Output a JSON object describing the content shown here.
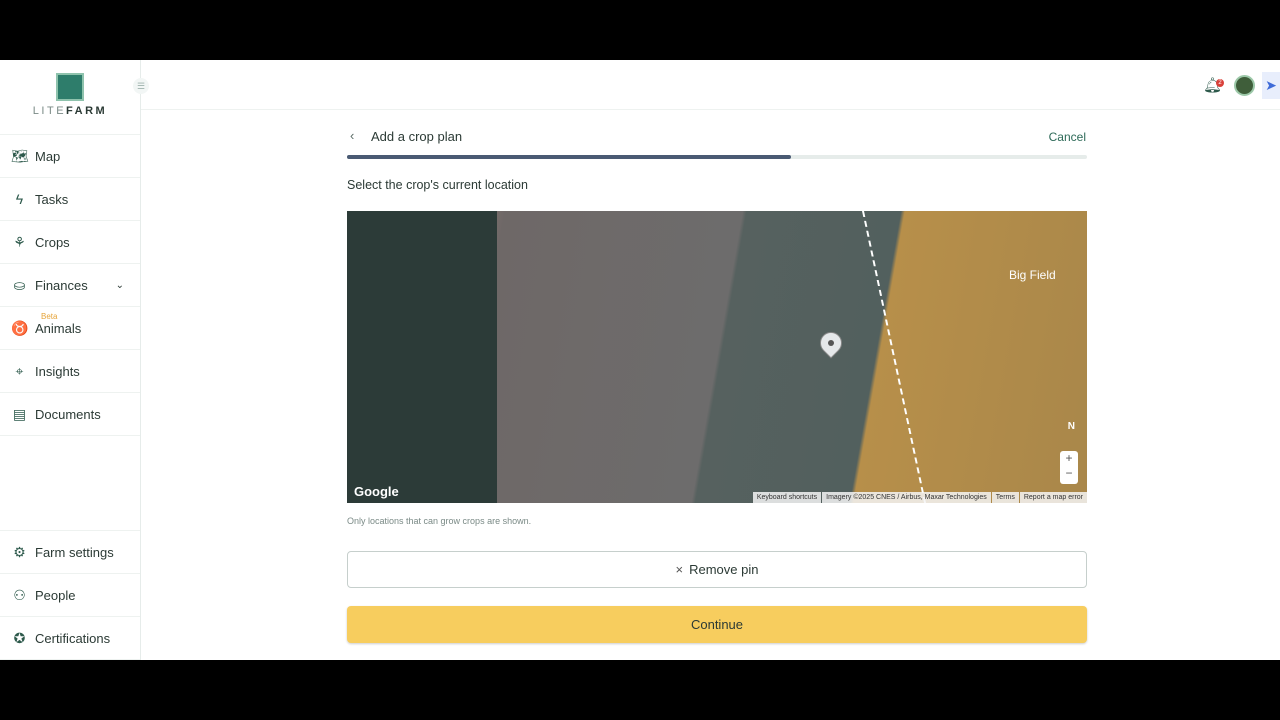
{
  "brand": {
    "lite": "LITE",
    "farm": "FARM"
  },
  "sidebar": {
    "items": [
      {
        "label": "Map",
        "icon": "🗺"
      },
      {
        "label": "Tasks",
        "icon": "ϟ"
      },
      {
        "label": "Crops",
        "icon": "⚘"
      },
      {
        "label": "Finances",
        "icon": "⛀",
        "chevron": "⌄"
      },
      {
        "label": "Animals",
        "icon": "♉",
        "badge": "Beta"
      },
      {
        "label": "Insights",
        "icon": "⌖"
      },
      {
        "label": "Documents",
        "icon": "▤"
      }
    ],
    "bottom": [
      {
        "label": "Farm settings",
        "icon": "⚙"
      },
      {
        "label": "People",
        "icon": "⚇"
      },
      {
        "label": "Certifications",
        "icon": "✪"
      }
    ]
  },
  "topbar": {
    "notification_count": "2"
  },
  "header": {
    "back": "‹",
    "title": "Add a crop plan",
    "cancel": "Cancel",
    "progress_percent": 60
  },
  "prompt": "Select the crop's current location",
  "map": {
    "field_label": "Big Field",
    "google": "Google",
    "north": "N",
    "zoom_in": "+",
    "zoom_out": "−",
    "attribution": [
      "Keyboard shortcuts",
      "Imagery ©2025 CNES / Airbus, Maxar Technologies",
      "Terms",
      "Report a map error"
    ]
  },
  "hint": "Only locations that can grow crops are shown.",
  "remove_pin": {
    "icon": "×",
    "label": "Remove pin"
  },
  "continue": "Continue"
}
